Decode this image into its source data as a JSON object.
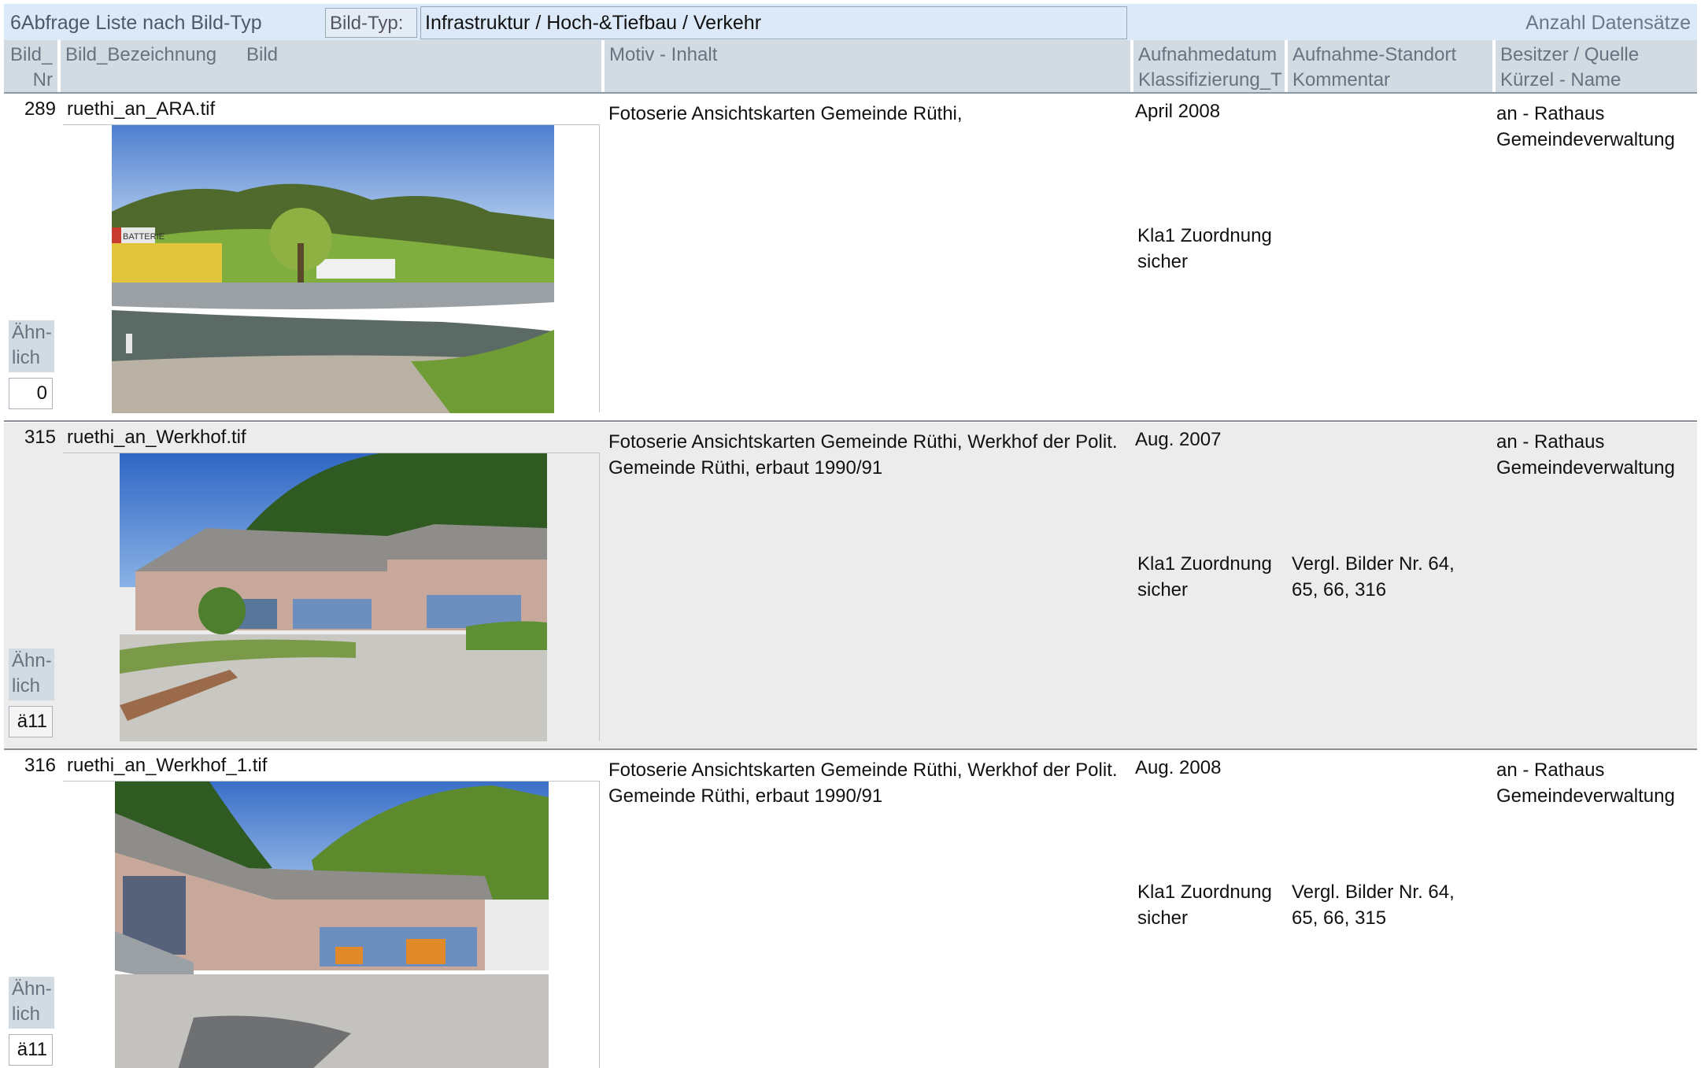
{
  "header": {
    "title": "6Abfrage Liste nach Bild-Typ",
    "bild_typ_label": "Bild-Typ:",
    "bild_typ_value": "Infrastruktur / Hoch-&Tiefbau / Verkehr",
    "count_label": "Anzahl Datensätze"
  },
  "columns": {
    "nr_line1": "Bild_",
    "nr_line2": "Nr",
    "bezeichnung": "Bild_Bezeichnung",
    "bild": "Bild",
    "motiv": "Motiv - Inhalt",
    "datum_line1": "Aufnahmedatum",
    "datum_line2": "Klassifizierung_T",
    "standort_line1": "Aufnahme-Standort",
    "standort_line2": "Kommentar",
    "besitzer_line1": "Besitzer / Quelle",
    "besitzer_line2": "Kürzel - Name"
  },
  "records": [
    {
      "nr": "289",
      "name": "ruethi_an_ARA.tif",
      "motiv": "Fotoserie Ansichtskarten Gemeinde Rüthi,",
      "datum": "April 2008",
      "klass_line1": "Kla1 Zuordnung",
      "klass_line2": "sicher",
      "kommentar": "",
      "besitzer_line1": "an - Rathaus",
      "besitzer_line2": "Gemeindeverwaltung",
      "aehnlich_label": "Ähn-lich",
      "aehnlich_value": "0",
      "photo_sign": "BATTERIE"
    },
    {
      "nr": "315",
      "name": "ruethi_an_Werkhof.tif",
      "motiv": "Fotoserie Ansichtskarten Gemeinde Rüthi, Werkhof der Polit. Gemeinde Rüthi, erbaut 1990/91",
      "datum": "Aug. 2007",
      "klass_line1": "Kla1 Zuordnung",
      "klass_line2": "sicher",
      "kommentar": "Vergl. Bilder Nr. 64, 65, 66, 316",
      "besitzer_line1": "an - Rathaus",
      "besitzer_line2": "Gemeindeverwaltung",
      "aehnlich_label": "Ähn-lich",
      "aehnlich_value": "ä11"
    },
    {
      "nr": "316",
      "name": "ruethi_an_Werkhof_1.tif",
      "motiv": "Fotoserie Ansichtskarten Gemeinde Rüthi, Werkhof der Polit. Gemeinde Rüthi, erbaut 1990/91",
      "datum": "Aug. 2008",
      "klass_line1": "Kla1 Zuordnung",
      "klass_line2": "sicher",
      "kommentar": "Vergl. Bilder Nr. 64, 65, 66, 315",
      "besitzer_line1": "an - Rathaus",
      "besitzer_line2": "Gemeindeverwaltung",
      "aehnlich_label": "Ähn-lich",
      "aehnlich_value": "ä11"
    }
  ]
}
